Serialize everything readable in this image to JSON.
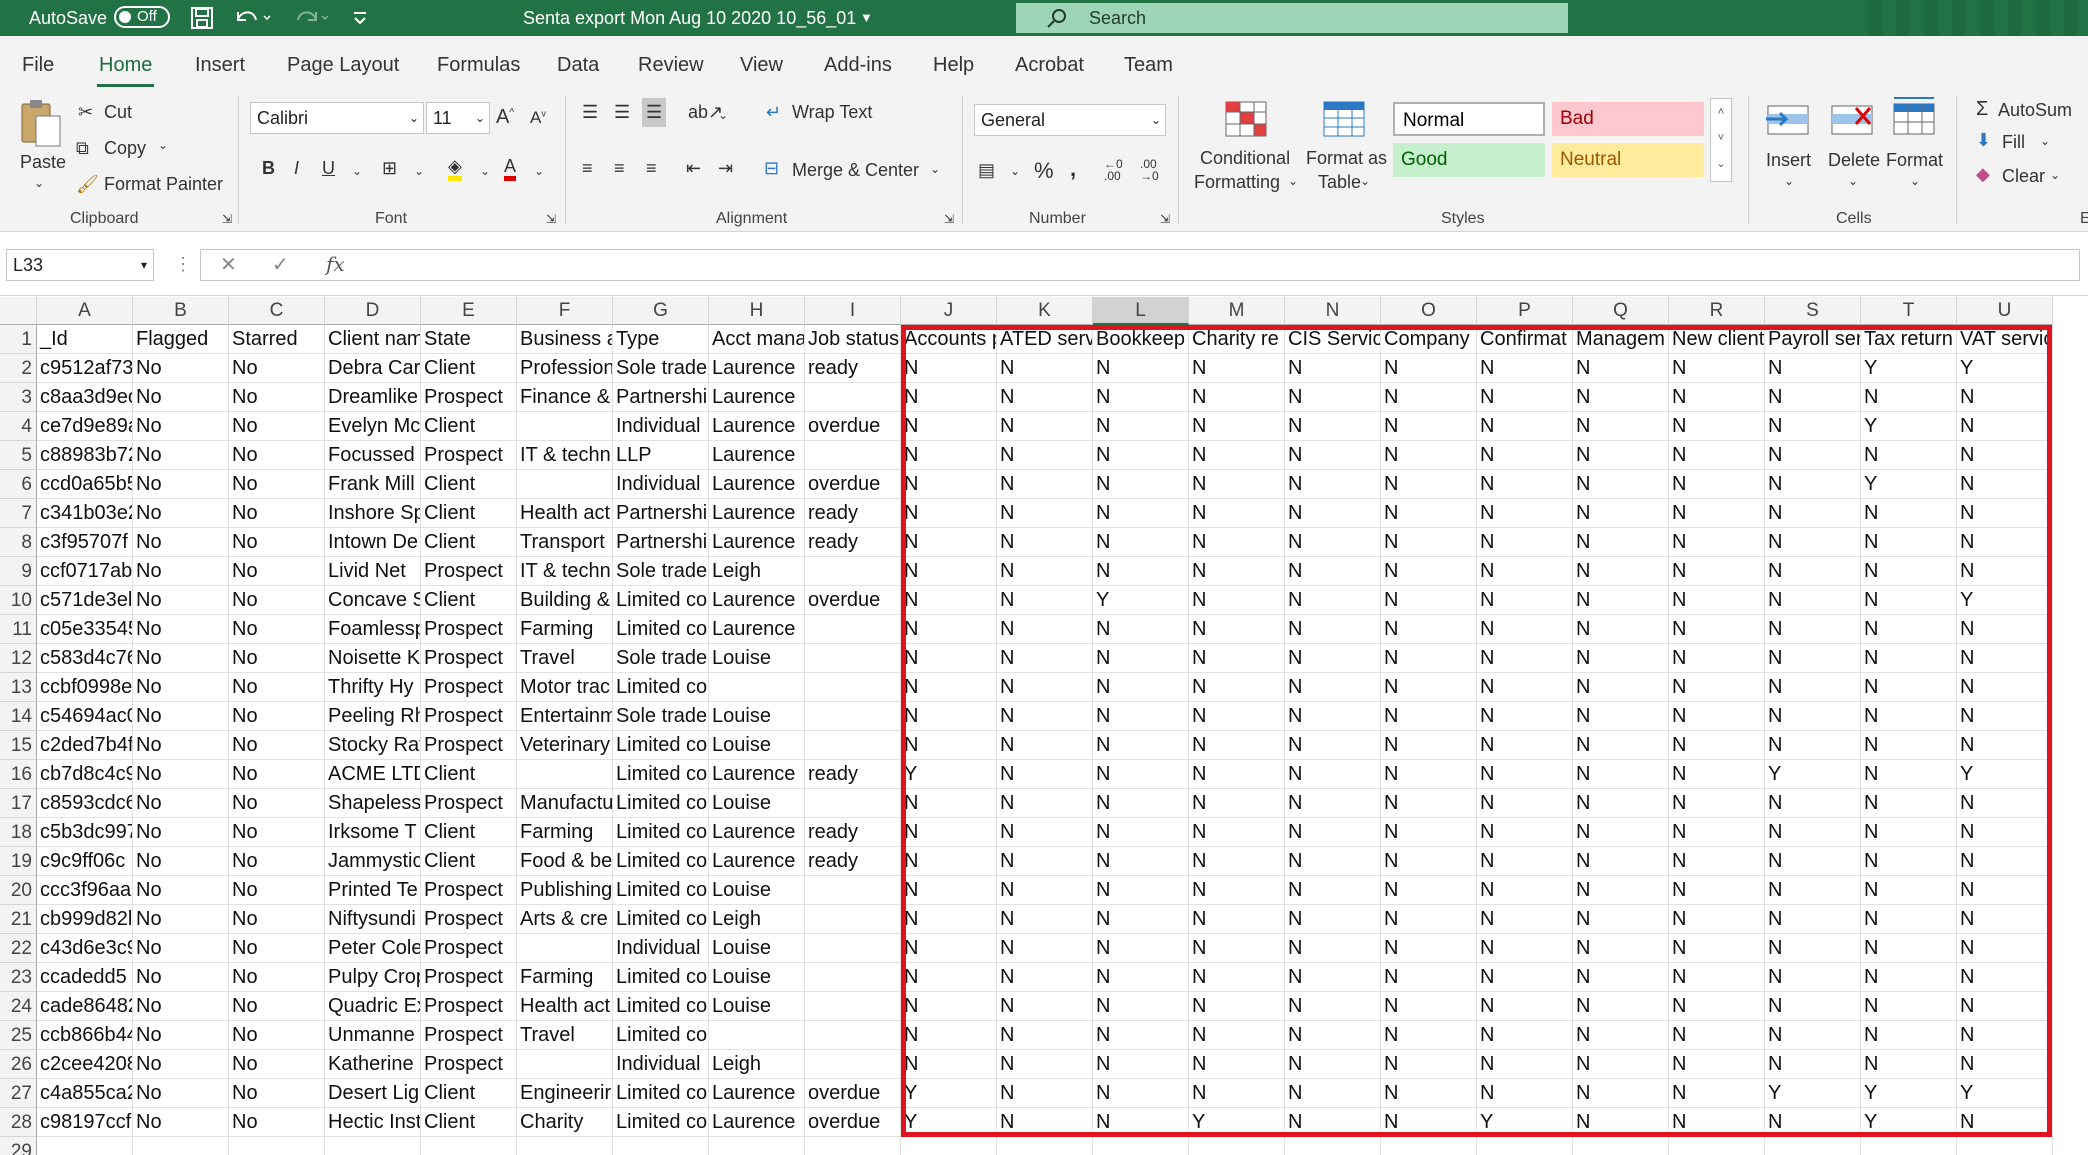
{
  "titlebar": {
    "autosave_label": "AutoSave",
    "autosave_state": "Off",
    "document_title": "Senta export Mon Aug 10 2020 10_56_01",
    "search_placeholder": "Search"
  },
  "tabs": [
    "File",
    "Home",
    "Insert",
    "Page Layout",
    "Formulas",
    "Data",
    "Review",
    "View",
    "Add-ins",
    "Help",
    "Acrobat",
    "Team"
  ],
  "active_tab": "Home",
  "ribbon": {
    "clipboard": {
      "paste": "Paste",
      "cut": "Cut",
      "copy": "Copy",
      "format_painter": "Format Painter",
      "group": "Clipboard"
    },
    "font": {
      "name": "Calibri",
      "size": "11",
      "group": "Font"
    },
    "alignment": {
      "wrap_text": "Wrap Text",
      "merge_center": "Merge & Center",
      "group": "Alignment"
    },
    "number": {
      "format": "General",
      "group": "Number"
    },
    "styles": {
      "conditional_formatting_1": "Conditional",
      "conditional_formatting_2": "Formatting",
      "format_as_table_1": "Format as",
      "format_as_table_2": "Table",
      "normal": "Normal",
      "bad": "Bad",
      "good": "Good",
      "neutral": "Neutral",
      "group": "Styles"
    },
    "cells": {
      "insert": "Insert",
      "delete": "Delete",
      "format": "Format",
      "group": "Cells"
    },
    "editing": {
      "autosum": "AutoSum",
      "fill": "Fill",
      "clear": "Clear",
      "group": "E"
    }
  },
  "formula_bar": {
    "name_box": "L33",
    "fx": "fx",
    "content": ""
  },
  "grid": {
    "columns": [
      "A",
      "B",
      "C",
      "D",
      "E",
      "F",
      "G",
      "H",
      "I",
      "J",
      "K",
      "L",
      "M",
      "N",
      "O",
      "P",
      "Q",
      "R",
      "S",
      "T",
      "U"
    ],
    "selected_column": "L",
    "rows": [
      [
        "_Id",
        "Flagged",
        "Starred",
        "Client nam",
        "State",
        "Business a",
        "Type",
        "Acct mana",
        "Job status",
        "Accounts p",
        "ATED serv",
        "Bookkeep",
        "Charity re",
        "CIS Service",
        "Company",
        "Confirmat",
        "Managem",
        "New client",
        "Payroll ser",
        "Tax return",
        "VAT service"
      ],
      [
        "c9512af73",
        "No",
        "No",
        "Debra Car",
        "Client",
        "Profession",
        "Sole trade",
        "Laurence",
        "ready",
        "N",
        "N",
        "N",
        "N",
        "N",
        "N",
        "N",
        "N",
        "N",
        "N",
        "Y",
        "Y"
      ],
      [
        "c8aa3d9ec",
        "No",
        "No",
        "Dreamlike",
        "Prospect",
        "Finance &",
        "Partnershi",
        "Laurence",
        "",
        "N",
        "N",
        "N",
        "N",
        "N",
        "N",
        "N",
        "N",
        "N",
        "N",
        "N",
        "N"
      ],
      [
        "ce7d9e89a",
        "No",
        "No",
        "Evelyn Mc",
        "Client",
        "",
        "Individual",
        "Laurence",
        "overdue",
        "N",
        "N",
        "N",
        "N",
        "N",
        "N",
        "N",
        "N",
        "N",
        "N",
        "Y",
        "N"
      ],
      [
        "c88983b72",
        "No",
        "No",
        "Focussed I",
        "Prospect",
        "IT & techn",
        "LLP",
        "Laurence",
        "",
        "N",
        "N",
        "N",
        "N",
        "N",
        "N",
        "N",
        "N",
        "N",
        "N",
        "N",
        "N"
      ],
      [
        "ccd0a65b5",
        "No",
        "No",
        "Frank Mill",
        "Client",
        "",
        "Individual",
        "Laurence",
        "overdue",
        "N",
        "N",
        "N",
        "N",
        "N",
        "N",
        "N",
        "N",
        "N",
        "N",
        "Y",
        "N"
      ],
      [
        "c341b03e2",
        "No",
        "No",
        "Inshore Sp",
        "Client",
        "Health act",
        "Partnershi",
        "Laurence",
        "ready",
        "N",
        "N",
        "N",
        "N",
        "N",
        "N",
        "N",
        "N",
        "N",
        "N",
        "N",
        "N"
      ],
      [
        "c3f95707f",
        "No",
        "No",
        "Intown De",
        "Client",
        "Transport",
        "Partnershi",
        "Laurence",
        "ready",
        "N",
        "N",
        "N",
        "N",
        "N",
        "N",
        "N",
        "N",
        "N",
        "N",
        "N",
        "N"
      ],
      [
        "ccf0717ab",
        "No",
        "No",
        "Livid Net",
        "Prospect",
        "IT & techn",
        "Sole trade",
        "Leigh",
        "",
        "N",
        "N",
        "N",
        "N",
        "N",
        "N",
        "N",
        "N",
        "N",
        "N",
        "N",
        "N"
      ],
      [
        "c571de3el",
        "No",
        "No",
        "Concave S",
        "Client",
        "Building &",
        "Limited co",
        "Laurence",
        "overdue",
        "N",
        "N",
        "Y",
        "N",
        "N",
        "N",
        "N",
        "N",
        "N",
        "N",
        "N",
        "Y"
      ],
      [
        "c05e33545",
        "No",
        "No",
        "Foamlessp",
        "Prospect",
        "Farming",
        "Limited co",
        "Laurence",
        "",
        "N",
        "N",
        "N",
        "N",
        "N",
        "N",
        "N",
        "N",
        "N",
        "N",
        "N",
        "N"
      ],
      [
        "c583d4c76",
        "No",
        "No",
        "Noisette K",
        "Prospect",
        "Travel",
        "Sole trade",
        "Louise",
        "",
        "N",
        "N",
        "N",
        "N",
        "N",
        "N",
        "N",
        "N",
        "N",
        "N",
        "N",
        "N"
      ],
      [
        "ccbf0998e",
        "No",
        "No",
        "Thrifty Hy",
        "Prospect",
        "Motor trac",
        "Limited co",
        "",
        "",
        "N",
        "N",
        "N",
        "N",
        "N",
        "N",
        "N",
        "N",
        "N",
        "N",
        "N",
        "N"
      ],
      [
        "c54694ac0",
        "No",
        "No",
        "Peeling Rh",
        "Prospect",
        "Entertainm",
        "Sole trade",
        "Louise",
        "",
        "N",
        "N",
        "N",
        "N",
        "N",
        "N",
        "N",
        "N",
        "N",
        "N",
        "N",
        "N"
      ],
      [
        "c2ded7b4f",
        "No",
        "No",
        "Stocky Rat",
        "Prospect",
        "Veterinary",
        "Limited co",
        "Louise",
        "",
        "N",
        "N",
        "N",
        "N",
        "N",
        "N",
        "N",
        "N",
        "N",
        "N",
        "N",
        "N"
      ],
      [
        "cb7d8c4c9",
        "No",
        "No",
        "ACME LTD",
        "Client",
        "",
        "Limited co",
        "Laurence",
        "ready",
        "Y",
        "N",
        "N",
        "N",
        "N",
        "N",
        "N",
        "N",
        "N",
        "Y",
        "N",
        "Y"
      ],
      [
        "c8593cdc6",
        "No",
        "No",
        "Shapeless",
        "Prospect",
        "Manufactu",
        "Limited co",
        "Louise",
        "",
        "N",
        "N",
        "N",
        "N",
        "N",
        "N",
        "N",
        "N",
        "N",
        "N",
        "N",
        "N"
      ],
      [
        "c5b3dc997",
        "No",
        "No",
        "Irksome T",
        "Client",
        "Farming",
        "Limited co",
        "Laurence",
        "ready",
        "N",
        "N",
        "N",
        "N",
        "N",
        "N",
        "N",
        "N",
        "N",
        "N",
        "N",
        "N"
      ],
      [
        "c9c9ff06c",
        "No",
        "No",
        "Jammystic",
        "Client",
        "Food & be",
        "Limited co",
        "Laurence",
        "ready",
        "N",
        "N",
        "N",
        "N",
        "N",
        "N",
        "N",
        "N",
        "N",
        "N",
        "N",
        "N"
      ],
      [
        "ccc3f96aa",
        "No",
        "No",
        "Printed Te",
        "Prospect",
        "Publishing",
        "Limited co",
        "Louise",
        "",
        "N",
        "N",
        "N",
        "N",
        "N",
        "N",
        "N",
        "N",
        "N",
        "N",
        "N",
        "N"
      ],
      [
        "cb999d82l",
        "No",
        "No",
        "Niftysundi",
        "Prospect",
        "Arts & cre",
        "Limited co",
        "Leigh",
        "",
        "N",
        "N",
        "N",
        "N",
        "N",
        "N",
        "N",
        "N",
        "N",
        "N",
        "N",
        "N"
      ],
      [
        "c43d6e3c9",
        "No",
        "No",
        "Peter Cole",
        "Prospect",
        "",
        "Individual",
        "Louise",
        "",
        "N",
        "N",
        "N",
        "N",
        "N",
        "N",
        "N",
        "N",
        "N",
        "N",
        "N",
        "N"
      ],
      [
        "ccadedd5",
        "No",
        "No",
        "Pulpy Crop",
        "Prospect",
        "Farming",
        "Limited co",
        "Louise",
        "",
        "N",
        "N",
        "N",
        "N",
        "N",
        "N",
        "N",
        "N",
        "N",
        "N",
        "N",
        "N"
      ],
      [
        "cade86482",
        "No",
        "No",
        "Quadric Ex",
        "Prospect",
        "Health act",
        "Limited co",
        "Louise",
        "",
        "N",
        "N",
        "N",
        "N",
        "N",
        "N",
        "N",
        "N",
        "N",
        "N",
        "N",
        "N"
      ],
      [
        "ccb866b44",
        "No",
        "No",
        "Unmanne",
        "Prospect",
        "Travel",
        "Limited co",
        "",
        "",
        "N",
        "N",
        "N",
        "N",
        "N",
        "N",
        "N",
        "N",
        "N",
        "N",
        "N",
        "N"
      ],
      [
        "c2cee4208",
        "No",
        "No",
        "Katherine",
        "Prospect",
        "",
        "Individual",
        "Leigh",
        "",
        "N",
        "N",
        "N",
        "N",
        "N",
        "N",
        "N",
        "N",
        "N",
        "N",
        "N",
        "N"
      ],
      [
        "c4a855ca2",
        "No",
        "No",
        "Desert Lig",
        "Client",
        "Engineerir",
        "Limited co",
        "Laurence",
        "overdue",
        "Y",
        "N",
        "N",
        "N",
        "N",
        "N",
        "N",
        "N",
        "N",
        "Y",
        "Y",
        "Y"
      ],
      [
        "c98197ccf",
        "No",
        "No",
        "Hectic Inst",
        "Client",
        "Charity",
        "Limited co",
        "Laurence",
        "overdue",
        "Y",
        "N",
        "N",
        "Y",
        "N",
        "N",
        "Y",
        "N",
        "N",
        "N",
        "Y",
        "N"
      ]
    ],
    "row_numbers": [
      "1",
      "2",
      "3",
      "4",
      "5",
      "6",
      "7",
      "8",
      "9",
      "10",
      "11",
      "12",
      "13",
      "14",
      "15",
      "16",
      "17",
      "18",
      "19",
      "20",
      "21",
      "22",
      "23",
      "24",
      "25",
      "26",
      "27",
      "28",
      "29"
    ],
    "highlight_color": "#e0141e"
  }
}
